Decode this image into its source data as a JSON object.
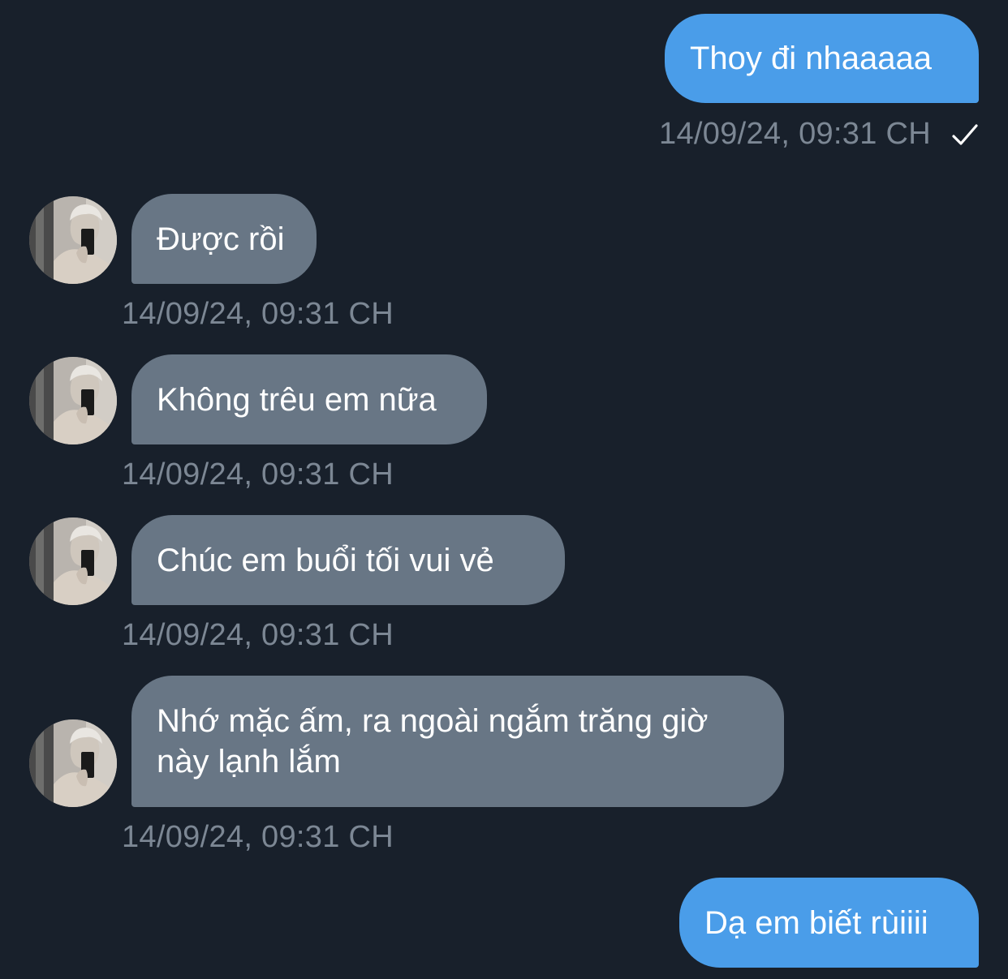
{
  "conversation": {
    "messages": [
      {
        "direction": "outgoing",
        "text": "Thoy đi nhaaaaa",
        "timestamp": "14/09/24, 09:31 CH",
        "status_icon": "check-icon"
      },
      {
        "direction": "incoming",
        "text": "Được rồi",
        "timestamp": "14/09/24, 09:31 CH"
      },
      {
        "direction": "incoming",
        "text": "Không trêu em nữa",
        "timestamp": "14/09/24, 09:31 CH"
      },
      {
        "direction": "incoming",
        "text": "Chúc em buổi tối vui vẻ",
        "timestamp": "14/09/24, 09:31 CH"
      },
      {
        "direction": "incoming",
        "text": "Nhớ mặc ấm, ra ngoài ngắm trăng giờ này lạnh lắm",
        "timestamp": "14/09/24, 09:31 CH"
      },
      {
        "direction": "outgoing",
        "text": "Dạ em biết rùiiii"
      }
    ]
  },
  "colors": {
    "background": "#18202b",
    "outgoing_bubble": "#4a9de9",
    "incoming_bubble": "#687685",
    "timestamp_text": "#7c8794"
  }
}
